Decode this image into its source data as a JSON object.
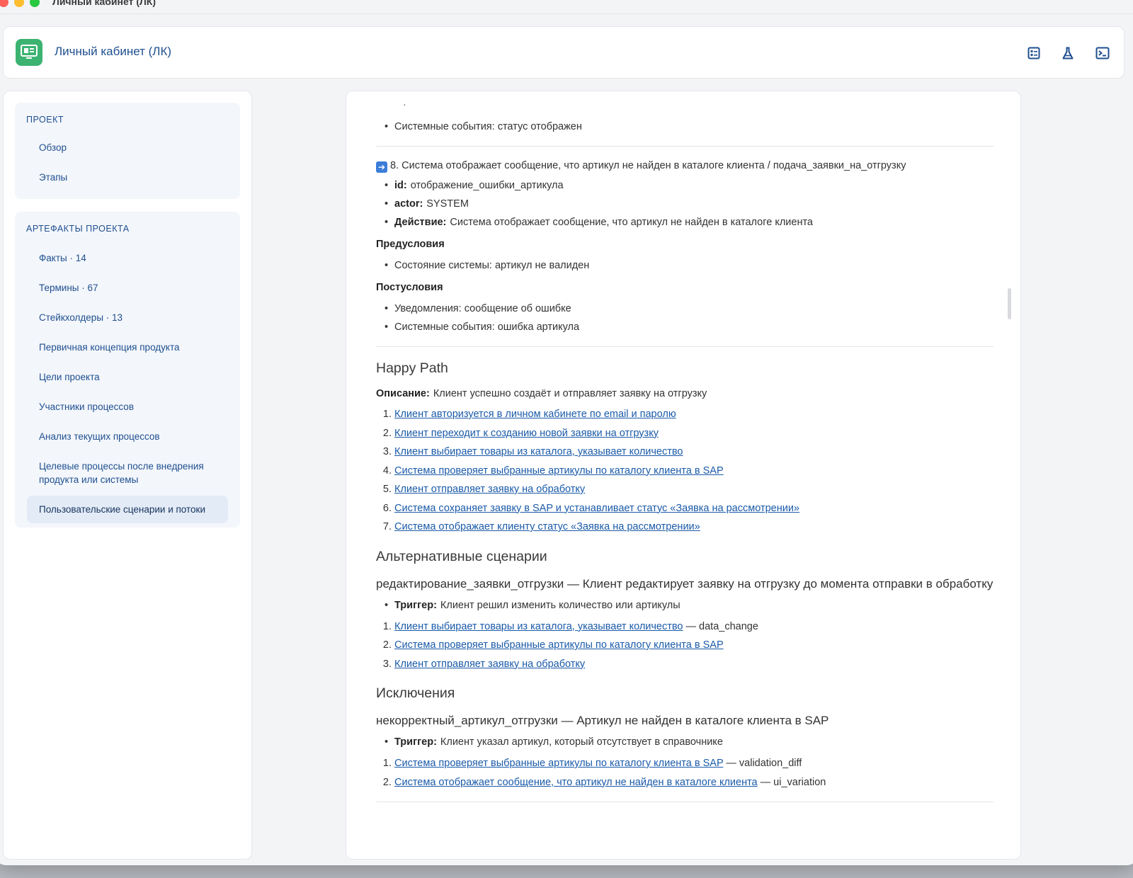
{
  "window": {
    "title": "Личный кабинет (ЛК)"
  },
  "header": {
    "title": "Личный кабинет (ЛК)",
    "logo_icon": "monitor-icon",
    "tools": [
      "list-icon",
      "flask-icon",
      "terminal-icon"
    ],
    "accent": "#3cb371"
  },
  "sidebar": {
    "groups": [
      {
        "title": "ПРОЕКТ",
        "items": [
          "Обзор",
          "Этапы"
        ]
      },
      {
        "title": "АРТЕФАКТЫ ПРОЕКТА",
        "items": [
          "Факты · 14",
          "Термины · 67",
          "Стейкхолдеры · 13",
          "Первичная концепция продукта",
          "Цели проекта",
          "Участники процессов",
          "Анализ текущих процессов",
          "Целевые процессы после внедрения продукта или системы",
          "Пользовательские сценарии и потоки"
        ],
        "active_index": 8
      }
    ]
  },
  "main": {
    "top_partial": "Системные события: статус отображен",
    "step8": {
      "title": "8. Система отображает сообщение, что артикул не найден в каталоге клиента / подача_заявки_на_отгрузку",
      "fields": [
        {
          "key": "id:",
          "value": "отображение_ошибки_артикула"
        },
        {
          "key": "actor:",
          "value": "SYSTEM"
        },
        {
          "key": "Действие:",
          "value": "Система отображает сообщение, что артикул не найден в каталоге клиента"
        }
      ],
      "pre_title": "Предусловия",
      "pre_items": [
        "Состояние системы: артикул не валиден"
      ],
      "post_title": "Постусловия",
      "post_items": [
        "Уведомления: сообщение об ошибке",
        "Системные события: ошибка артикула"
      ]
    },
    "happy": {
      "title": "Happy Path",
      "desc_key": "Описание:",
      "desc": "Клиент успешно создаёт и отправляет заявку на отгрузку",
      "steps": [
        {
          "n": "1.",
          "text": "Клиент авторизуется в личном кабинете по email и паролю"
        },
        {
          "n": "2.",
          "text": "Клиент переходит к созданию новой заявки на отгрузку"
        },
        {
          "n": "3.",
          "text": "Клиент выбирает товары из каталога, указывает количество"
        },
        {
          "n": "4.",
          "text": "Система проверяет выбранные артикулы по каталогу клиента в SAP"
        },
        {
          "n": "5.",
          "text": "Клиент отправляет заявку на обработку"
        },
        {
          "n": "6.",
          "text": "Система сохраняет заявку в SAP и устанавливает статус «Заявка на рассмотрении»"
        },
        {
          "n": "7.",
          "text": "Система отображает клиенту статус «Заявка на рассмотрении»"
        }
      ]
    },
    "alt": {
      "title": "Альтернативные сценарии",
      "scenario": "редактирование_заявки_отгрузки — Клиент редактирует заявку на отгрузку до момента отправки в обработку",
      "trigger_key": "Триггер:",
      "trigger": "Клиент решил изменить количество или артикулы",
      "steps": [
        {
          "n": "1.",
          "text": "Клиент выбирает товары из каталога, указывает количество",
          "suffix": " — data_change"
        },
        {
          "n": "2.",
          "text": "Система проверяет выбранные артикулы по каталогу клиента в SAP",
          "suffix": ""
        },
        {
          "n": "3.",
          "text": "Клиент отправляет заявку на обработку",
          "suffix": ""
        }
      ]
    },
    "exc": {
      "title": "Исключения",
      "scenario": "некорректный_артикул_отгрузки — Артикул не найден в каталоге клиента в SAP",
      "trigger_key": "Триггер:",
      "trigger": "Клиент указал артикул, который отсутствует в справочнике",
      "steps": [
        {
          "n": "1.",
          "text": "Система проверяет выбранные артикулы по каталогу клиента в SAP",
          "suffix": " — validation_diff"
        },
        {
          "n": "2.",
          "text": "Система отображает сообщение, что артикул не найден в каталоге клиента",
          "suffix": " — ui_variation"
        }
      ]
    }
  }
}
